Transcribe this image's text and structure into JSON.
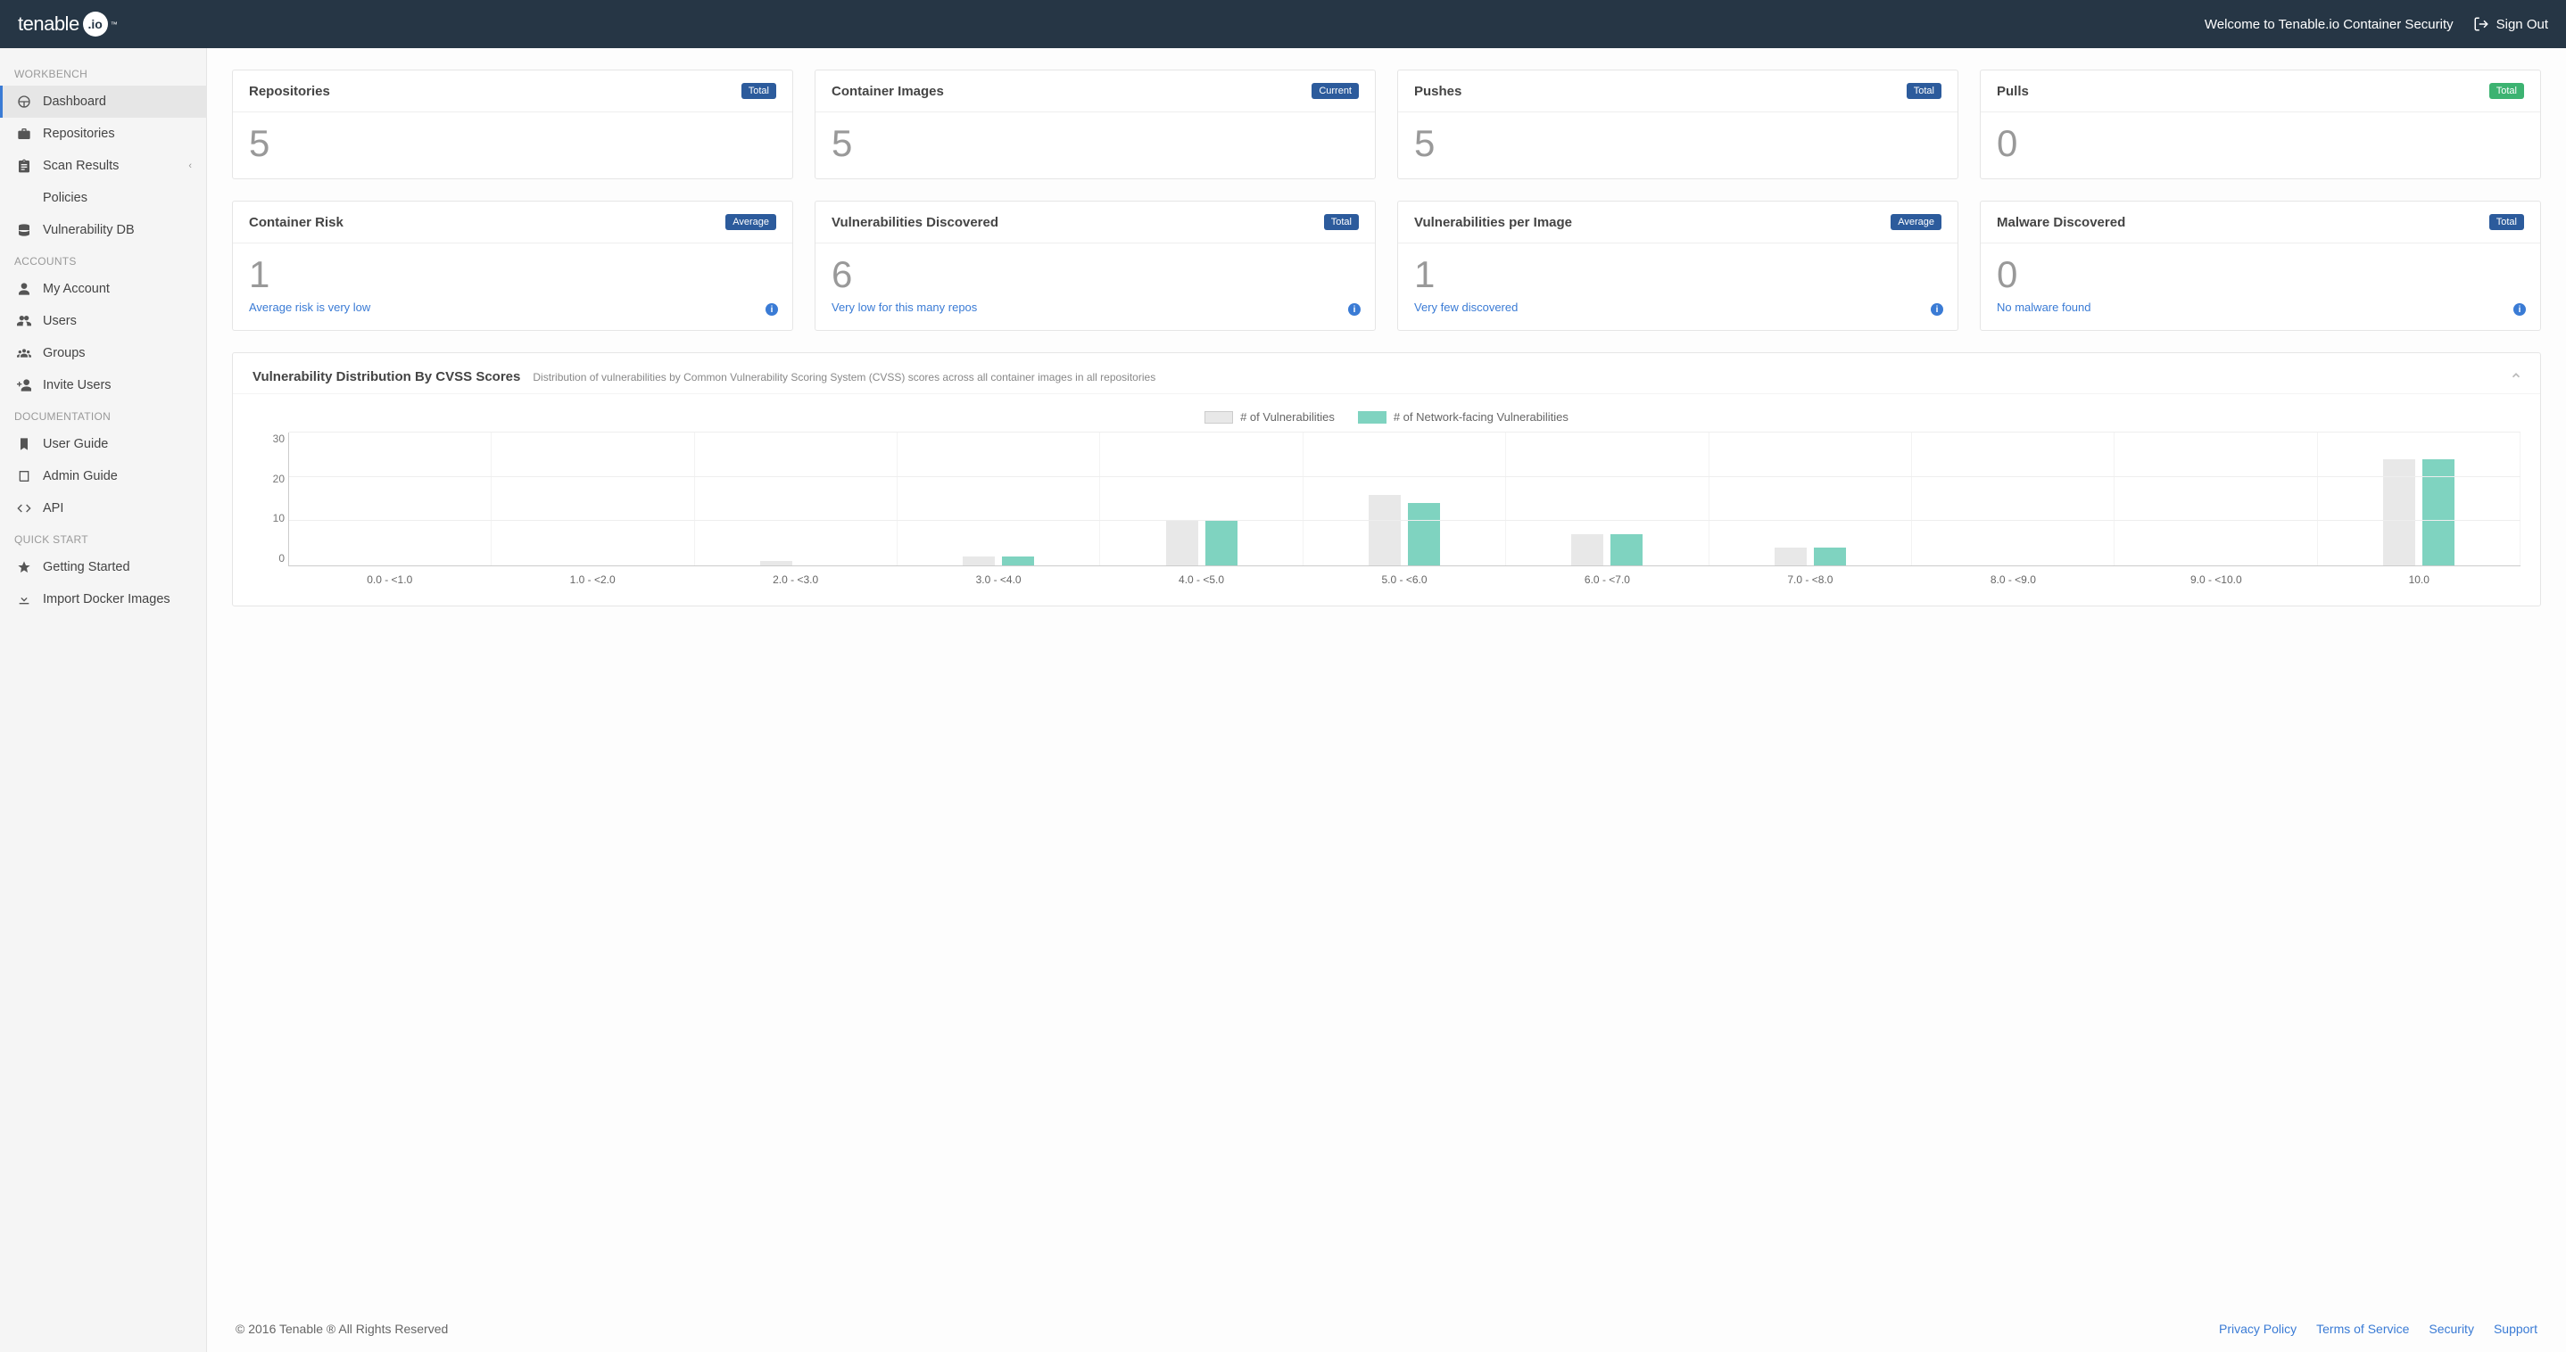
{
  "header": {
    "logo_text": "tenable",
    "logo_dot": ".io",
    "logo_tm": "™",
    "welcome": "Welcome to Tenable.io Container Security",
    "sign_out": "Sign Out"
  },
  "sidebar": {
    "sections": {
      "workbench": {
        "title": "WORKBENCH",
        "items": [
          {
            "label": "Dashboard",
            "icon": "dashboard"
          },
          {
            "label": "Repositories",
            "icon": "briefcase"
          },
          {
            "label": "Scan Results",
            "icon": "clipboard",
            "expandable": true
          },
          {
            "label": "Policies",
            "icon": "sliders"
          },
          {
            "label": "Vulnerability DB",
            "icon": "database"
          }
        ]
      },
      "accounts": {
        "title": "ACCOUNTS",
        "items": [
          {
            "label": "My Account",
            "icon": "user"
          },
          {
            "label": "Users",
            "icon": "users"
          },
          {
            "label": "Groups",
            "icon": "group"
          },
          {
            "label": "Invite Users",
            "icon": "invite"
          }
        ]
      },
      "documentation": {
        "title": "DOCUMENTATION",
        "items": [
          {
            "label": "User Guide",
            "icon": "bookmark"
          },
          {
            "label": "Admin Guide",
            "icon": "book"
          },
          {
            "label": "API",
            "icon": "code"
          }
        ]
      },
      "quickstart": {
        "title": "QUICK START",
        "items": [
          {
            "label": "Getting Started",
            "icon": "star"
          },
          {
            "label": "Import Docker Images",
            "icon": "download"
          }
        ]
      }
    }
  },
  "cards": {
    "row1": [
      {
        "title": "Repositories",
        "badge": "Total",
        "badge_color": "blue",
        "value": "5"
      },
      {
        "title": "Container Images",
        "badge": "Current",
        "badge_color": "blue",
        "value": "5"
      },
      {
        "title": "Pushes",
        "badge": "Total",
        "badge_color": "blue",
        "value": "5"
      },
      {
        "title": "Pulls",
        "badge": "Total",
        "badge_color": "green",
        "value": "0"
      }
    ],
    "row2": [
      {
        "title": "Container Risk",
        "badge": "Average",
        "badge_color": "blue",
        "value": "1",
        "msg": "Average risk is very low"
      },
      {
        "title": "Vulnerabilities Discovered",
        "badge": "Total",
        "badge_color": "blue",
        "value": "6",
        "msg": "Very low for this many repos"
      },
      {
        "title": "Vulnerabilities per Image",
        "badge": "Average",
        "badge_color": "blue",
        "value": "1",
        "msg": "Very few discovered"
      },
      {
        "title": "Malware Discovered",
        "badge": "Total",
        "badge_color": "blue",
        "value": "0",
        "msg": "No malware found"
      }
    ]
  },
  "chart_panel": {
    "title": "Vulnerability Distribution By CVSS Scores",
    "subtitle": "Distribution of vulnerabilities by Common Vulnerability Scoring System (CVSS) scores across all container images in all repositories",
    "legend": {
      "a": "# of Vulnerabilities",
      "b": "# of Network-facing Vulnerabilities"
    }
  },
  "chart_data": {
    "type": "bar",
    "categories": [
      "0.0 - <1.0",
      "1.0 - <2.0",
      "2.0 - <3.0",
      "3.0 - <4.0",
      "4.0 - <5.0",
      "5.0 - <6.0",
      "6.0 - <7.0",
      "7.0 - <8.0",
      "8.0 - <9.0",
      "9.0 - <10.0",
      "10.0"
    ],
    "series": [
      {
        "name": "# of Vulnerabilities",
        "color": "#e8e8e8",
        "values": [
          0,
          0,
          1,
          2,
          10,
          16,
          7,
          4,
          0,
          0,
          24
        ]
      },
      {
        "name": "# of Network-facing Vulnerabilities",
        "color": "#7fd3c0",
        "values": [
          0,
          0,
          0,
          2,
          10,
          14,
          7,
          4,
          0,
          0,
          24
        ]
      }
    ],
    "ylim": [
      0,
      30
    ],
    "yticks": [
      0,
      10,
      20,
      30
    ],
    "xlabel": "",
    "ylabel": ""
  },
  "footer": {
    "copyright": "© 2016 Tenable ® All Rights Reserved",
    "links": [
      "Privacy Policy",
      "Terms of Service",
      "Security",
      "Support"
    ]
  }
}
